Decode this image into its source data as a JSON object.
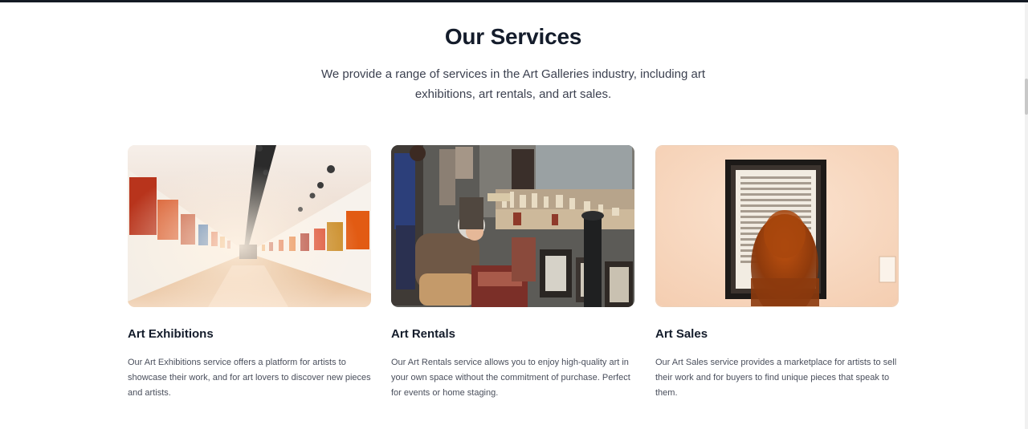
{
  "section": {
    "title": "Our Services",
    "subtitle": "We provide a range of services in the Art Galleries industry, including art exhibitions, art rentals, and art sales."
  },
  "services": [
    {
      "title": "Art Exhibitions",
      "description": "Our Art Exhibitions service offers a platform for artists to showcase their work, and for art lovers to discover new pieces and artists.",
      "image_icon": "gallery-corridor-photo"
    },
    {
      "title": "Art Rentals",
      "description": "Our Art Rentals service allows you to enjoy high-quality art in your own space without the commitment of purchase. Perfect for events or home staging.",
      "image_icon": "bookstall-photo"
    },
    {
      "title": "Art Sales",
      "description": "Our Art Sales service provides a marketplace for artists to sell their work and for buyers to find unique pieces that speak to them.",
      "image_icon": "framed-artwork-photo"
    }
  ],
  "colors": {
    "heading": "#141c2b",
    "body_text": "#4a4f5c",
    "top_bar": "#141a24"
  }
}
